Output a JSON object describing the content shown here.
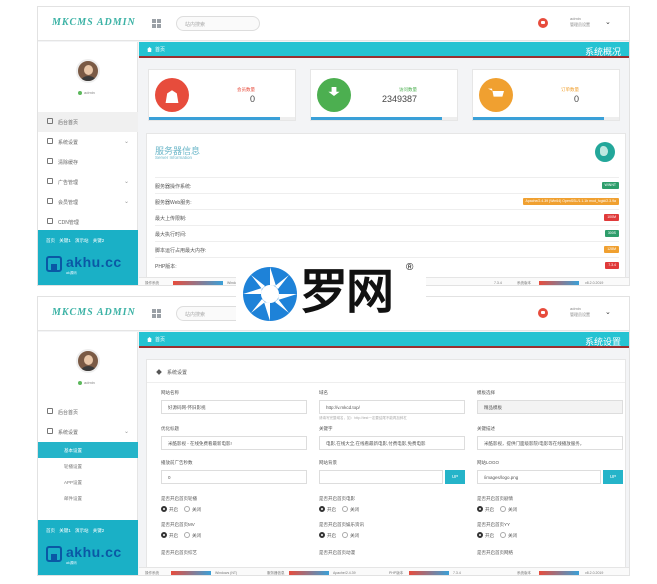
{
  "common": {
    "logo": "MKCMS ADMIN",
    "search_placeholder": "站内搜索",
    "user_line1": "admin",
    "user_line2": "管理员设置",
    "online": "admin",
    "side_links": "首页 关键1 演示站 关键2",
    "brand_text": "akhu.cc",
    "brand_sub": "ak源码",
    "crumb": "首页"
  },
  "dashboard": {
    "section_title": "系统概况",
    "menu": [
      {
        "label": "后台首页",
        "icon": "monitor-icon"
      },
      {
        "label": "系统设置",
        "icon": "settings-icon"
      },
      {
        "label": "清除缓存",
        "icon": "trash-icon"
      },
      {
        "label": "广告管理",
        "icon": "image-icon"
      },
      {
        "label": "会员管理",
        "icon": "users-icon"
      },
      {
        "label": "CDN管理",
        "icon": "table-icon"
      }
    ],
    "stats": [
      {
        "label": "会员数量",
        "value": "0",
        "color": "#e74c3c",
        "bar": "#3aa0d8",
        "fill": 0.9
      },
      {
        "label": "访问数量",
        "value": "2349387",
        "color": "#4caf50",
        "bar": "#3aa0d8",
        "fill": 0.9
      },
      {
        "label": "订单数量",
        "value": "0",
        "color": "#f0a030",
        "bar": "#3aa0d8",
        "fill": 0.9
      }
    ],
    "server_title": "服务器信息",
    "server_sub": "Server Information",
    "rows": [
      {
        "label": "服务器操作系统:",
        "tag": "WINNT",
        "color": "#2e9d6b"
      },
      {
        "label": "服务器Web服务:",
        "tag": "Apache/2.4.39 (Win64) OpenSSL/1.1.1b mod_fcgid/2.3.9a",
        "color": "#f0a030"
      },
      {
        "label": "最大上传限制:",
        "tag": "100M",
        "color": "#e03a3a"
      },
      {
        "label": "最大执行时间:",
        "tag": "300S",
        "color": "#2e9d6b"
      },
      {
        "label": "脚本运行占用最大内存:",
        "tag": "128M",
        "color": "#f0a030"
      },
      {
        "label": "PHP版本:",
        "tag": "7.3.4",
        "color": "#e03a3a"
      }
    ],
    "footer": {
      "a": "操作系统",
      "a_val": "Windows",
      "b_val": "7.3.4",
      "c": "系统版本",
      "c_val": "v8.2.0.2019"
    }
  },
  "settings": {
    "section_title": "系统设置",
    "menu": [
      {
        "label": "后台首页",
        "icon": "monitor-icon"
      },
      {
        "label": "系统设置",
        "icon": "settings-icon"
      }
    ],
    "sub": [
      "基本设置",
      "轮播设置",
      "APP设置",
      "邮件设置"
    ],
    "card_title": "系统设置",
    "fields": [
      {
        "label": "网站名称",
        "value": "好源码网-怀旧影视"
      },
      {
        "label": "域名",
        "value": "http://v.mkcd.top/",
        "hint": "请填写完整域名，如：http://test一定要结尾不能再加斜杠"
      },
      {
        "label": "模板选择",
        "value": "精品模板"
      },
      {
        "label": "优化标题",
        "value": "米酷影视 - 在线免费看最新电影!"
      },
      {
        "label": "关键字",
        "value": "电影,在线大全,在线看最新电影,付费电影,免费电影"
      },
      {
        "label": "关键描述",
        "value": "米酷影视，提供门面级影院/电影等在线播放服务，"
      },
      {
        "label": "播放前广告秒数",
        "value": "0"
      },
      {
        "label": "网站背景",
        "value": "",
        "up": "UP"
      },
      {
        "label": "网站LOGO",
        "value": "/images/logo.png",
        "up": "UP"
      }
    ],
    "radios": [
      {
        "label": "是否开启首页轮播",
        "on": "开启",
        "off": "关闭"
      },
      {
        "label": "是否开启首页电影",
        "on": "开启",
        "off": "关闭"
      },
      {
        "label": "是否开启首页剧情",
        "on": "开启",
        "off": "关闭"
      },
      {
        "label": "是否开启首页MV",
        "on": "开启",
        "off": "关闭"
      },
      {
        "label": "是否开启首页娱乐资讯",
        "on": "开启",
        "off": "关闭"
      },
      {
        "label": "是否开启首页YY",
        "on": "开启",
        "off": "关闭"
      }
    ],
    "more_row": [
      "是否开启首页综艺",
      "是否开启首页动漫",
      "是否开启首页网络"
    ],
    "footer": {
      "a": "操作系统",
      "a_val": "Windows (NT)",
      "b": "服务器信息",
      "b_val": "Apache/2.4.39",
      "c": "PHP版本",
      "c_val": "7.3.4",
      "d": "系统版本",
      "d_val": "v8.2.0.2019"
    }
  },
  "watermark": {
    "text": "罗网",
    "reg": "®"
  }
}
